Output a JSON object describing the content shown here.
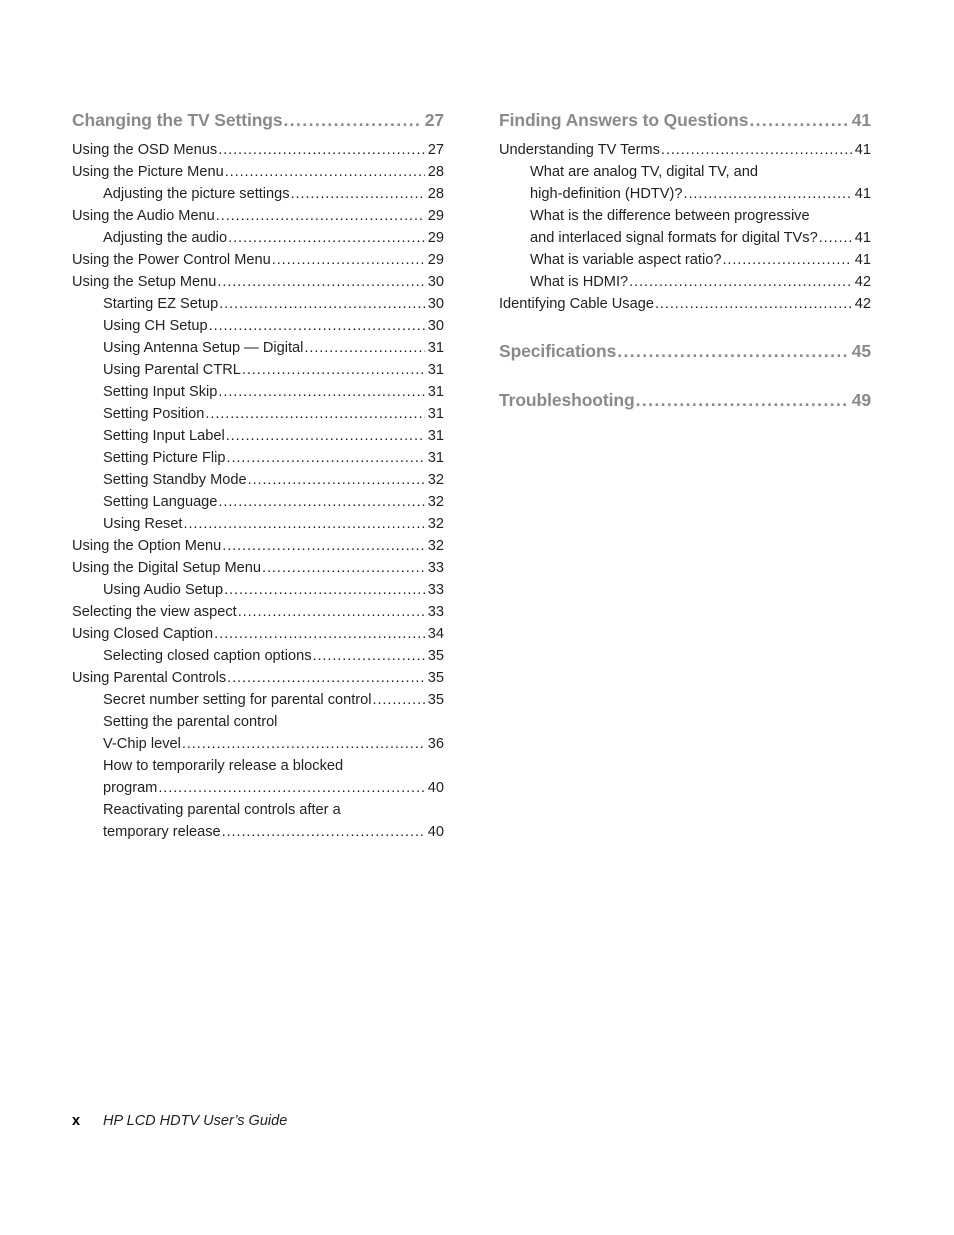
{
  "document": {
    "footer": {
      "page_number": "x",
      "guide_title": "HP LCD HDTV User’s Guide"
    }
  },
  "leader_dots": "..................................................................................................................................",
  "left_column": {
    "heading": {
      "label": "Changing the TV Settings",
      "page": "27"
    },
    "entries": [
      {
        "level": 1,
        "label": "Using the OSD Menus",
        "page": "27"
      },
      {
        "level": 1,
        "label": "Using the Picture Menu",
        "page": "28"
      },
      {
        "level": 2,
        "label": "Adjusting the picture settings",
        "page": "28"
      },
      {
        "level": 1,
        "label": "Using the Audio Menu",
        "page": "29"
      },
      {
        "level": 2,
        "label": "Adjusting the audio",
        "page": "29"
      },
      {
        "level": 1,
        "label": "Using the Power Control Menu",
        "page": "29"
      },
      {
        "level": 1,
        "label": "Using the Setup Menu",
        "page": "30"
      },
      {
        "level": 2,
        "label": "Starting EZ Setup",
        "page": "30"
      },
      {
        "level": 2,
        "label": "Using CH Setup",
        "page": "30"
      },
      {
        "level": 2,
        "label": "Using Antenna Setup — Digital",
        "page": "31"
      },
      {
        "level": 2,
        "label": "Using Parental CTRL",
        "page": "31"
      },
      {
        "level": 2,
        "label": "Setting Input Skip",
        "page": "31"
      },
      {
        "level": 2,
        "label": "Setting Position",
        "page": "31"
      },
      {
        "level": 2,
        "label": "Setting Input Label",
        "page": "31"
      },
      {
        "level": 2,
        "label": "Setting Picture Flip",
        "page": "31"
      },
      {
        "level": 2,
        "label": "Setting Standby Mode",
        "page": "32"
      },
      {
        "level": 2,
        "label": "Setting Language",
        "page": "32"
      },
      {
        "level": 2,
        "label": "Using Reset",
        "page": "32"
      },
      {
        "level": 1,
        "label": "Using the Option Menu",
        "page": "32"
      },
      {
        "level": 1,
        "label": "Using the Digital Setup Menu",
        "page": "33"
      },
      {
        "level": 2,
        "label": "Using Audio Setup",
        "page": "33"
      },
      {
        "level": 1,
        "label": "Selecting the view aspect",
        "page": "33"
      },
      {
        "level": 1,
        "label": "Using Closed Caption",
        "page": "34"
      },
      {
        "level": 2,
        "label": "Selecting closed caption options",
        "page": "35"
      },
      {
        "level": 1,
        "label": "Using Parental Controls",
        "page": "35"
      },
      {
        "level": 2,
        "label": "Secret number setting for parental control",
        "page": "35"
      },
      {
        "level": 2,
        "lines": [
          "Setting the parental control"
        ],
        "label": "V-Chip level",
        "page": "36"
      },
      {
        "level": 2,
        "lines": [
          "How to temporarily release a blocked"
        ],
        "label": "program",
        "page": "40"
      },
      {
        "level": 2,
        "lines": [
          "Reactivating parental controls after a"
        ],
        "label": "temporary release",
        "page": "40"
      }
    ]
  },
  "right_column": {
    "heading": {
      "label": "Finding Answers to Questions",
      "page": "41"
    },
    "entries": [
      {
        "level": 1,
        "label": "Understanding TV Terms",
        "page": "41"
      },
      {
        "level": 2,
        "lines": [
          "What are analog TV, digital TV, and"
        ],
        "label": "high-definition (HDTV)?",
        "page": "41"
      },
      {
        "level": 2,
        "lines": [
          "What is the difference between progressive"
        ],
        "label": "and interlaced signal formats for digital TVs?",
        "page": "41"
      },
      {
        "level": 2,
        "label": "What is variable aspect ratio?",
        "page": "41"
      },
      {
        "level": 2,
        "label": "What is HDMI?",
        "page": "42"
      },
      {
        "level": 1,
        "label": "Identifying Cable Usage",
        "page": "42"
      }
    ],
    "extra_headings": [
      {
        "label": "Specifications",
        "page": "45"
      },
      {
        "label": "Troubleshooting",
        "page": "49"
      }
    ]
  }
}
